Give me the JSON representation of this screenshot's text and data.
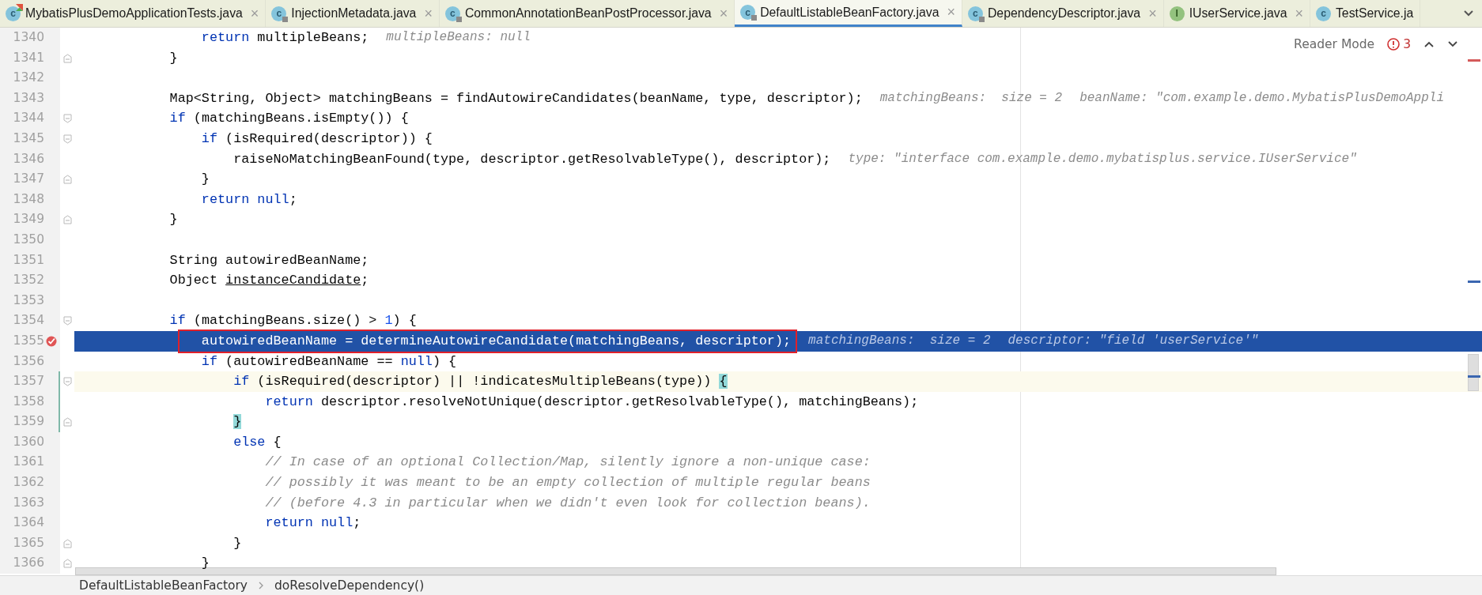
{
  "tabs": [
    {
      "label": "MybatisPlusDemoApplicationTests.java",
      "icon": "c",
      "kind": "class",
      "runnable": true,
      "locked": false,
      "selected": false,
      "close": "×"
    },
    {
      "label": "InjectionMetadata.java",
      "icon": "c",
      "kind": "class",
      "runnable": false,
      "locked": true,
      "selected": false,
      "close": "×"
    },
    {
      "label": "CommonAnnotationBeanPostProcessor.java",
      "icon": "c",
      "kind": "class",
      "runnable": false,
      "locked": true,
      "selected": false,
      "close": "×"
    },
    {
      "label": "DefaultListableBeanFactory.java",
      "icon": "c",
      "kind": "class",
      "runnable": false,
      "locked": true,
      "selected": true,
      "close": "×"
    },
    {
      "label": "DependencyDescriptor.java",
      "icon": "c",
      "kind": "class",
      "runnable": false,
      "locked": true,
      "selected": false,
      "close": "×"
    },
    {
      "label": "IUserService.java",
      "icon": "I",
      "kind": "interface",
      "runnable": false,
      "locked": false,
      "selected": false,
      "close": "×"
    },
    {
      "label": "TestService.ja",
      "icon": "c",
      "kind": "class",
      "runnable": false,
      "locked": false,
      "selected": false
    }
  ],
  "editor_toolbar": {
    "reader_mode": "Reader Mode",
    "problems": "3"
  },
  "lines": [
    {
      "number": "1340",
      "segments": [
        {
          "t": "            return",
          "kind": "keyword"
        },
        {
          "t": " multipleBeans;"
        }
      ],
      "hints": [
        "multipleBeans: null"
      ]
    },
    {
      "number": "1341",
      "fold_end": true,
      "segments": [
        {
          "t": "        }"
        }
      ]
    },
    {
      "number": "1342"
    },
    {
      "number": "1343",
      "segments": [
        {
          "t": "        Map<String, Object> matchingBeans = findAutowireCandidates(beanName, type, descriptor);"
        }
      ],
      "hints": [
        "matchingBeans:  size = 2",
        "beanName: \"com.example.demo.MybatisPlusDemoAppli"
      ]
    },
    {
      "number": "1344",
      "fold_start": true,
      "segments": [
        {
          "t": "        if",
          "kind": "keyword"
        },
        {
          "t": " (matchingBeans.isEmpty()) {"
        }
      ]
    },
    {
      "number": "1345",
      "fold_start": true,
      "segments": [
        {
          "t": "            if",
          "kind": "keyword"
        },
        {
          "t": " (isRequired(descriptor)) {"
        }
      ]
    },
    {
      "number": "1346",
      "segments": [
        {
          "t": "                raiseNoMatchingBeanFound(type, descriptor.getResolvableType(), descriptor);"
        }
      ],
      "hints": [
        "type: \"interface com.example.demo.mybatisplus.service.IUserService\""
      ]
    },
    {
      "number": "1347",
      "fold_end": true,
      "segments": [
        {
          "t": "            }"
        }
      ]
    },
    {
      "number": "1348",
      "segments": [
        {
          "t": "            return null",
          "kind": "keyword"
        },
        {
          "t": ";"
        }
      ]
    },
    {
      "number": "1349",
      "fold_end": true,
      "segments": [
        {
          "t": "        }"
        }
      ]
    },
    {
      "number": "1350"
    },
    {
      "number": "1351",
      "segments": [
        {
          "t": "        String autowiredBeanName;"
        }
      ]
    },
    {
      "number": "1352",
      "segments": [
        {
          "t": "        Object "
        },
        {
          "t": "instanceCandidate",
          "kind": "underline"
        },
        {
          "t": ";"
        }
      ]
    },
    {
      "number": "1353"
    },
    {
      "number": "1354",
      "fold_start": true,
      "segments": [
        {
          "t": "        if",
          "kind": "keyword"
        },
        {
          "t": " (matchingBeans.size() > "
        },
        {
          "t": "1",
          "kind": "number"
        },
        {
          "t": ") {"
        }
      ]
    },
    {
      "number": "1355",
      "breakpoint": true,
      "execution": true,
      "boxed": true,
      "segments": [
        {
          "t": "            autowiredBeanName = determineAutowireCandidate(matchingBeans, descriptor);"
        }
      ],
      "hints": [
        "matchingBeans:  size = 2",
        "descriptor: \"field 'userService'\""
      ]
    },
    {
      "number": "1356",
      "segments": [
        {
          "t": "            if",
          "kind": "keyword"
        },
        {
          "t": " (autowiredBeanName == "
        },
        {
          "t": "null",
          "kind": "keyword"
        },
        {
          "t": ") {"
        }
      ]
    },
    {
      "number": "1357",
      "fold_start": true,
      "caret": true,
      "changed": true,
      "segments": [
        {
          "t": "                if",
          "kind": "keyword"
        },
        {
          "t": " (isRequired(descriptor) || !indicatesMultipleBeans(type)) "
        },
        {
          "t": "{",
          "kind": "brace"
        }
      ]
    },
    {
      "number": "1358",
      "changed": true,
      "segments": [
        {
          "t": "                    return",
          "kind": "keyword"
        },
        {
          "t": " descriptor.resolveNotUnique(descriptor.getResolvableType(), matchingBeans);"
        }
      ]
    },
    {
      "number": "1359",
      "fold_end": true,
      "changed": true,
      "segments": [
        {
          "t": "                }",
          "kind": "brace"
        }
      ]
    },
    {
      "number": "1360",
      "segments": [
        {
          "t": "                else",
          "kind": "keyword"
        },
        {
          "t": " {"
        }
      ]
    },
    {
      "number": "1361",
      "segments": [
        {
          "t": "                    // In case of an optional Collection/Map, silently ignore a non-unique case:",
          "kind": "comment"
        }
      ]
    },
    {
      "number": "1362",
      "segments": [
        {
          "t": "                    // possibly it was meant to be an empty collection of multiple regular beans",
          "kind": "comment"
        }
      ]
    },
    {
      "number": "1363",
      "segments": [
        {
          "t": "                    // (before 4.3 in particular when we didn't even look for collection beans).",
          "kind": "comment"
        }
      ]
    },
    {
      "number": "1364",
      "segments": [
        {
          "t": "                    return null",
          "kind": "keyword"
        },
        {
          "t": ";"
        }
      ]
    },
    {
      "number": "1365",
      "fold_end": true,
      "segments": [
        {
          "t": "                }"
        }
      ]
    },
    {
      "number": "1366",
      "fold_end": true,
      "segments": [
        {
          "t": "            }"
        }
      ]
    }
  ],
  "breadcrumbs": [
    "DefaultListableBeanFactory",
    "doResolveDependency()"
  ]
}
